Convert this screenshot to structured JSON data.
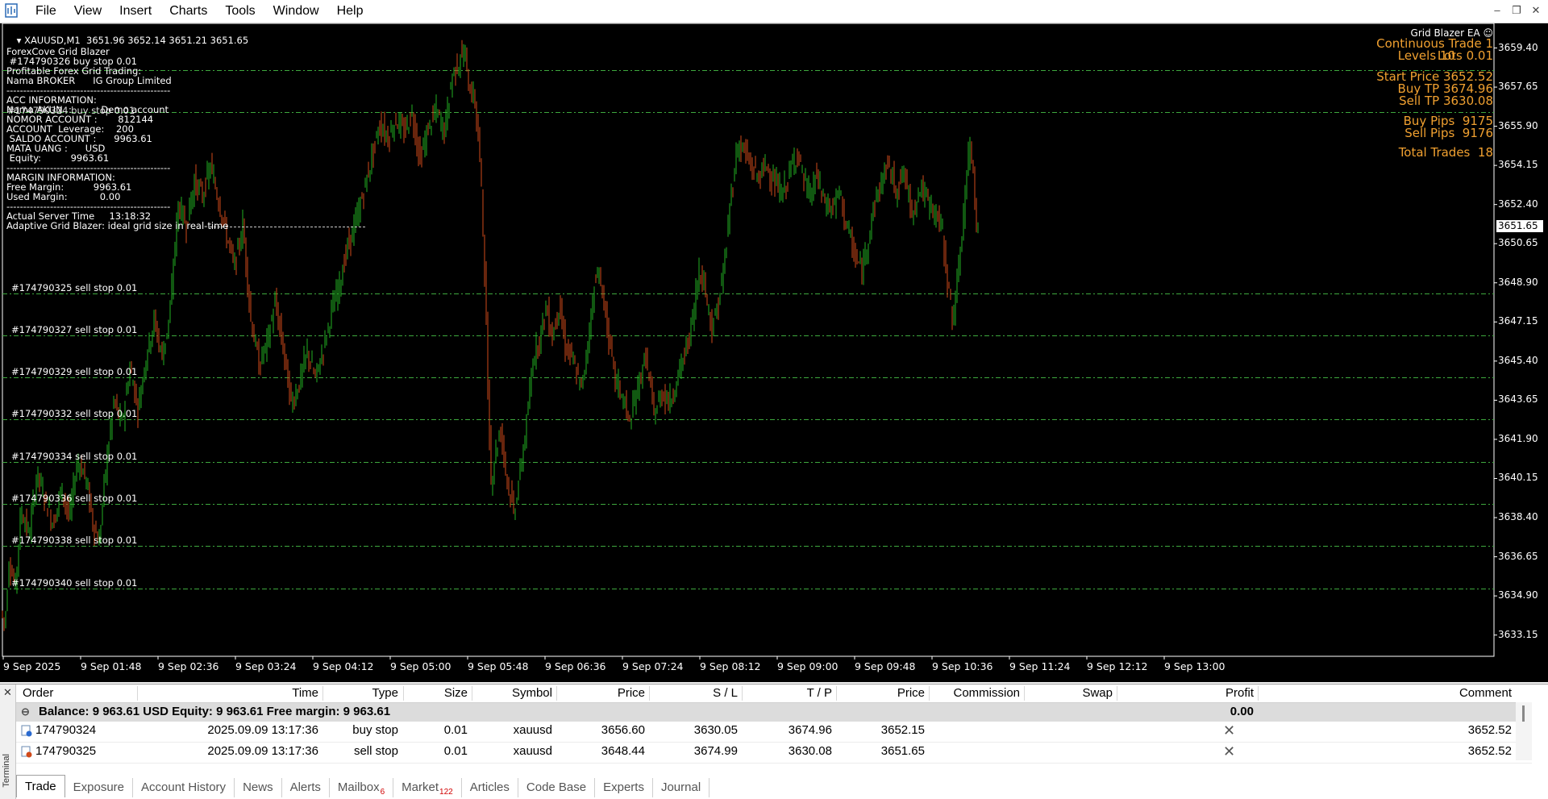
{
  "app": {
    "menus": [
      "File",
      "View",
      "Insert",
      "Charts",
      "Tools",
      "Window",
      "Help"
    ],
    "window_buttons": [
      "–",
      "❐",
      "✕"
    ]
  },
  "chart": {
    "header": "XAUUSD,M1  3651.96 3652.14 3651.21 3651.65",
    "current_price_label": "3651.65",
    "info_panel_lines": [
      "ForexCove Grid Blazer",
      " #174790326 buy stop 0.01",
      "Profitable Forex Grid Trading:",
      "Nama BROKER      IG Group Limited",
      "-------------------------------------------------",
      "ACC INFORMATION:",
      "Nama AKUN  :          Demo account",
      "NOMOR ACCOUNT :       812144",
      "ACCOUNT  Leverage:    200",
      " SALDO ACCOUNT :      9963.61",
      "MATA UANG :      USD",
      " Equity:          9963.61",
      "-------------------------------------------------",
      "MARGIN INFORMATION:",
      "Free Margin:          9963.61",
      "Used Margin:           0.00",
      "-------------------------------------------------",
      "Actual Server Time     13:18:32",
      "Adaptive Grid Blazer: ideal grid size in real-time"
    ],
    "overlay_extra": "#174790324 buy stop 0.01",
    "ea_title": "Grid Blazer EA ☺",
    "ea_panel": {
      "continuous_trade": "Continuous Trade 1",
      "levels": "Levels 10",
      "lots": "Lots 0.01",
      "start_price": "Start Price 3652.52",
      "buy_tp": "Buy TP 3674.96",
      "sell_tp": "Sell TP 3630.08",
      "buy_pips": "Buy Pips  9175",
      "sell_pips": "Sell Pips  9176",
      "total_trades": "Total Trades  18"
    },
    "grid_lines": [
      {
        "price": 3658.41,
        "label": ""
      },
      {
        "price": 3656.52,
        "label": ""
      },
      {
        "price": 3648.44,
        "label": "#174790325 sell stop 0.01"
      },
      {
        "price": 3646.56,
        "label": "#174790327 sell stop 0.01"
      },
      {
        "price": 3644.67,
        "label": "#174790329 sell stop 0.01"
      },
      {
        "price": 3642.79,
        "label": "#174790332 sell stop 0.01"
      },
      {
        "price": 3640.9,
        "label": "#174790334 sell stop 0.01"
      },
      {
        "price": 3639.01,
        "label": "#174790336 sell stop 0.01"
      },
      {
        "price": 3637.13,
        "label": "#174790338 sell stop 0.01"
      },
      {
        "price": 3635.24,
        "label": "#174790340 sell stop 0.01"
      }
    ],
    "price_axis": [
      "3659.40",
      "3657.65",
      "3655.90",
      "3654.15",
      "3652.40",
      "3650.65",
      "3648.90",
      "3647.15",
      "3645.40",
      "3643.65",
      "3641.90",
      "3640.15",
      "3638.40",
      "3636.65",
      "3634.90",
      "3633.15"
    ],
    "time_axis": [
      "9 Sep 2025",
      "9 Sep 01:48",
      "9 Sep 02:36",
      "9 Sep 03:24",
      "9 Sep 04:12",
      "9 Sep 05:00",
      "9 Sep 05:48",
      "9 Sep 06:36",
      "9 Sep 07:24",
      "9 Sep 08:12",
      "9 Sep 09:00",
      "9 Sep 09:48",
      "9 Sep 10:36",
      "9 Sep 11:24",
      "9 Sep 12:12",
      "9 Sep 13:00"
    ],
    "colors": {
      "background": "#000000",
      "bull": "#22b022",
      "bear": "#d04a1a",
      "grid_line": "#3ea83e",
      "ea_text": "#f0a030",
      "axis": "#ffffff"
    },
    "price_path": [
      [
        0,
        3634.2
      ],
      [
        5,
        3633.6
      ],
      [
        10,
        3636.5
      ],
      [
        18,
        3635.3
      ],
      [
        25,
        3638.8
      ],
      [
        35,
        3637.6
      ],
      [
        45,
        3640.4
      ],
      [
        55,
        3639.2
      ],
      [
        65,
        3638.1
      ],
      [
        75,
        3639.7
      ],
      [
        85,
        3638.4
      ],
      [
        95,
        3641.0
      ],
      [
        105,
        3640.2
      ],
      [
        115,
        3638.0
      ],
      [
        122,
        3637.3
      ],
      [
        130,
        3640.6
      ],
      [
        140,
        3643.6
      ],
      [
        150,
        3642.6
      ],
      [
        160,
        3645.1
      ],
      [
        170,
        3643.3
      ],
      [
        180,
        3645.6
      ],
      [
        190,
        3647.2
      ],
      [
        200,
        3645.6
      ],
      [
        210,
        3647.6
      ],
      [
        215,
        3650.2
      ],
      [
        220,
        3652.4
      ],
      [
        230,
        3651.5
      ],
      [
        240,
        3653.4
      ],
      [
        250,
        3652.8
      ],
      [
        260,
        3654.1
      ],
      [
        270,
        3652.6
      ],
      [
        280,
        3651.0
      ],
      [
        290,
        3649.6
      ],
      [
        300,
        3651.5
      ],
      [
        310,
        3647.3
      ],
      [
        320,
        3645.2
      ],
      [
        330,
        3646.2
      ],
      [
        340,
        3648.0
      ],
      [
        350,
        3646.0
      ],
      [
        360,
        3643.5
      ],
      [
        370,
        3644.4
      ],
      [
        380,
        3645.8
      ],
      [
        390,
        3644.6
      ],
      [
        400,
        3646.0
      ],
      [
        410,
        3647.6
      ],
      [
        420,
        3648.9
      ],
      [
        430,
        3650.5
      ],
      [
        440,
        3651.6
      ],
      [
        450,
        3653.0
      ],
      [
        460,
        3654.5
      ],
      [
        470,
        3656.0
      ],
      [
        480,
        3655.4
      ],
      [
        490,
        3656.2
      ],
      [
        500,
        3655.6
      ],
      [
        510,
        3656.5
      ],
      [
        520,
        3654.4
      ],
      [
        530,
        3655.8
      ],
      [
        540,
        3656.6
      ],
      [
        550,
        3655.7
      ],
      [
        560,
        3658.2
      ],
      [
        570,
        3658.9
      ],
      [
        575,
        3659.3
      ],
      [
        580,
        3657.8
      ],
      [
        588,
        3657.0
      ],
      [
        595,
        3654.0
      ],
      [
        600,
        3649.5
      ],
      [
        604,
        3644.0
      ],
      [
        608,
        3640.0
      ],
      [
        614,
        3641.5
      ],
      [
        620,
        3642.3
      ],
      [
        628,
        3640.1
      ],
      [
        636,
        3638.6
      ],
      [
        642,
        3639.9
      ],
      [
        648,
        3641.5
      ],
      [
        654,
        3643.2
      ],
      [
        660,
        3645.6
      ],
      [
        668,
        3646.4
      ],
      [
        676,
        3647.8
      ],
      [
        684,
        3646.5
      ],
      [
        692,
        3647.9
      ],
      [
        700,
        3646.1
      ],
      [
        710,
        3645.3
      ],
      [
        720,
        3644.1
      ],
      [
        730,
        3646.8
      ],
      [
        738,
        3649.4
      ],
      [
        746,
        3648.6
      ],
      [
        754,
        3646.3
      ],
      [
        762,
        3644.6
      ],
      [
        770,
        3643.9
      ],
      [
        780,
        3642.6
      ],
      [
        790,
        3644.3
      ],
      [
        800,
        3645.6
      ],
      [
        810,
        3643.0
      ],
      [
        820,
        3644.0
      ],
      [
        830,
        3643.6
      ],
      [
        840,
        3644.8
      ],
      [
        850,
        3645.9
      ],
      [
        858,
        3647.3
      ],
      [
        866,
        3649.6
      ],
      [
        874,
        3648.6
      ],
      [
        882,
        3646.8
      ],
      [
        890,
        3648.0
      ],
      [
        898,
        3649.9
      ],
      [
        906,
        3653.0
      ],
      [
        914,
        3655.1
      ],
      [
        922,
        3654.8
      ],
      [
        930,
        3654.1
      ],
      [
        940,
        3653.6
      ],
      [
        950,
        3654.2
      ],
      [
        960,
        3653.3
      ],
      [
        970,
        3652.9
      ],
      [
        980,
        3654.0
      ],
      [
        988,
        3654.8
      ],
      [
        996,
        3653.4
      ],
      [
        1004,
        3652.8
      ],
      [
        1012,
        3653.7
      ],
      [
        1020,
        3652.6
      ],
      [
        1030,
        3652.2
      ],
      [
        1040,
        3652.9
      ],
      [
        1050,
        3651.3
      ],
      [
        1060,
        3650.0
      ],
      [
        1068,
        3649.4
      ],
      [
        1076,
        3651.0
      ],
      [
        1084,
        3652.5
      ],
      [
        1092,
        3653.4
      ],
      [
        1100,
        3654.2
      ],
      [
        1110,
        3653.1
      ],
      [
        1120,
        3653.8
      ],
      [
        1130,
        3652.0
      ],
      [
        1140,
        3653.2
      ],
      [
        1150,
        3652.5
      ],
      [
        1160,
        3652.0
      ],
      [
        1168,
        3651.1
      ],
      [
        1175,
        3648.6
      ],
      [
        1180,
        3647.3
      ],
      [
        1186,
        3648.7
      ],
      [
        1192,
        3651.2
      ],
      [
        1198,
        3653.8
      ],
      [
        1202,
        3655.0
      ],
      [
        1206,
        3654.0
      ],
      [
        1210,
        3651.6
      ]
    ]
  },
  "terminal": {
    "side_label": "Terminal",
    "columns": [
      "Order",
      "Time",
      "Type",
      "Size",
      "Symbol",
      "Price",
      "S / L",
      "T / P",
      "Price",
      "Commission",
      "Swap",
      "Profit",
      "Comment"
    ],
    "balance_row": {
      "text": "Balance: 9 963.61 USD  Equity: 9 963.61  Free margin: 9 963.61",
      "profit": "0.00"
    },
    "rows": [
      {
        "order": "174790324",
        "time": "2025.09.09 13:17:36",
        "type": "buy stop",
        "size": "0.01",
        "symbol": "xauusd",
        "price": "3656.60",
        "sl": "3630.05",
        "tp": "3674.96",
        "cur_price": "3652.15",
        "commission": "",
        "swap": "",
        "profit": "",
        "comment": "3652.52"
      },
      {
        "order": "174790325",
        "time": "2025.09.09 13:17:36",
        "type": "sell stop",
        "size": "0.01",
        "symbol": "xauusd",
        "price": "3648.44",
        "sl": "3674.99",
        "tp": "3630.08",
        "cur_price": "3651.65",
        "commission": "",
        "swap": "",
        "profit": "",
        "comment": "3652.52"
      }
    ],
    "tabs": [
      {
        "label": "Trade",
        "badge": ""
      },
      {
        "label": "Exposure",
        "badge": ""
      },
      {
        "label": "Account History",
        "badge": ""
      },
      {
        "label": "News",
        "badge": ""
      },
      {
        "label": "Alerts",
        "badge": ""
      },
      {
        "label": "Mailbox",
        "badge": "6"
      },
      {
        "label": "Market",
        "badge": "122"
      },
      {
        "label": "Articles",
        "badge": ""
      },
      {
        "label": "Code Base",
        "badge": ""
      },
      {
        "label": "Experts",
        "badge": ""
      },
      {
        "label": "Journal",
        "badge": ""
      }
    ]
  }
}
